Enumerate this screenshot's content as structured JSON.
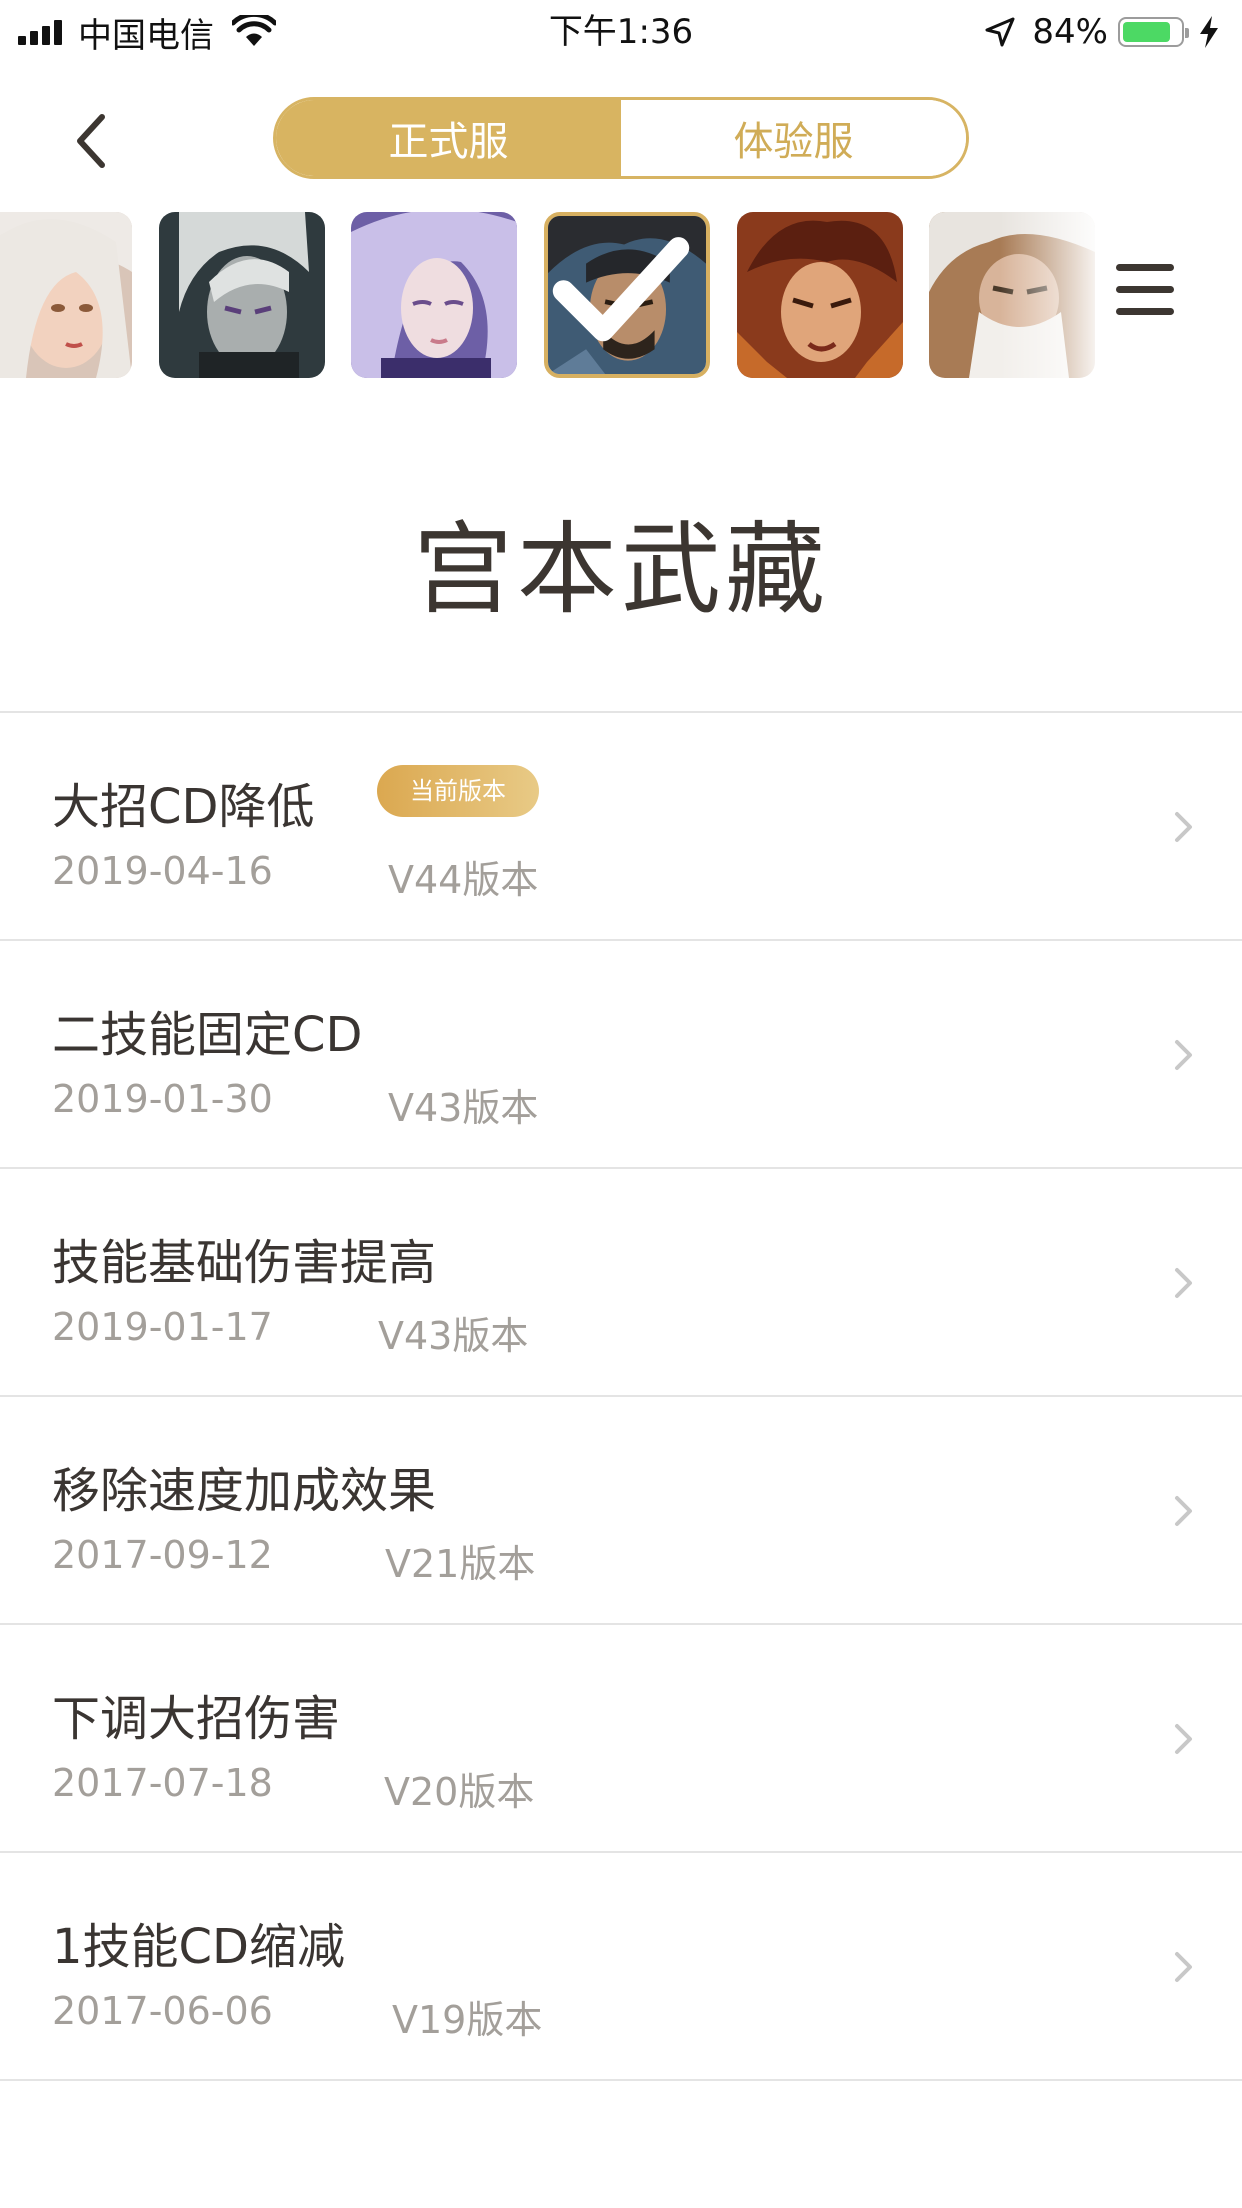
{
  "status_bar": {
    "carrier": "中国电信",
    "time": "下午1:36",
    "battery_percent": "84%",
    "battery_level": 0.84,
    "icons": [
      "signal-icon",
      "wifi-icon",
      "location-icon",
      "battery-icon",
      "charging-icon"
    ]
  },
  "nav": {
    "back_icon": "chevron-left-icon",
    "tabs": [
      {
        "label": "正式服",
        "active": true
      },
      {
        "label": "体验服",
        "active": false
      }
    ]
  },
  "hero_strip": {
    "selected_index": 3,
    "menu_icon": "hamburger-menu-icon"
  },
  "title": "宫本武藏",
  "changes": [
    {
      "title": "大招CD降低",
      "date": "2019-04-16",
      "version": "V44版本",
      "badge": "当前版本"
    },
    {
      "title": "二技能固定CD",
      "date": "2019-01-30",
      "version": "V43版本"
    },
    {
      "title": "技能基础伤害提高",
      "date": "2019-01-17",
      "version": "V43版本"
    },
    {
      "title": "移除速度加成效果",
      "date": "2017-09-12",
      "version": "V21版本"
    },
    {
      "title": "下调大招伤害",
      "date": "2017-07-18",
      "version": "V20版本"
    },
    {
      "title": "1技能CD缩减",
      "date": "2017-06-06",
      "version": "V19版本"
    }
  ],
  "colors": {
    "accent_gold": "#d8b461",
    "badge_gold": "#dba850",
    "title_text": "#3c3631",
    "meta_text": "#a39f9a",
    "divider": "#e4e4e4"
  }
}
